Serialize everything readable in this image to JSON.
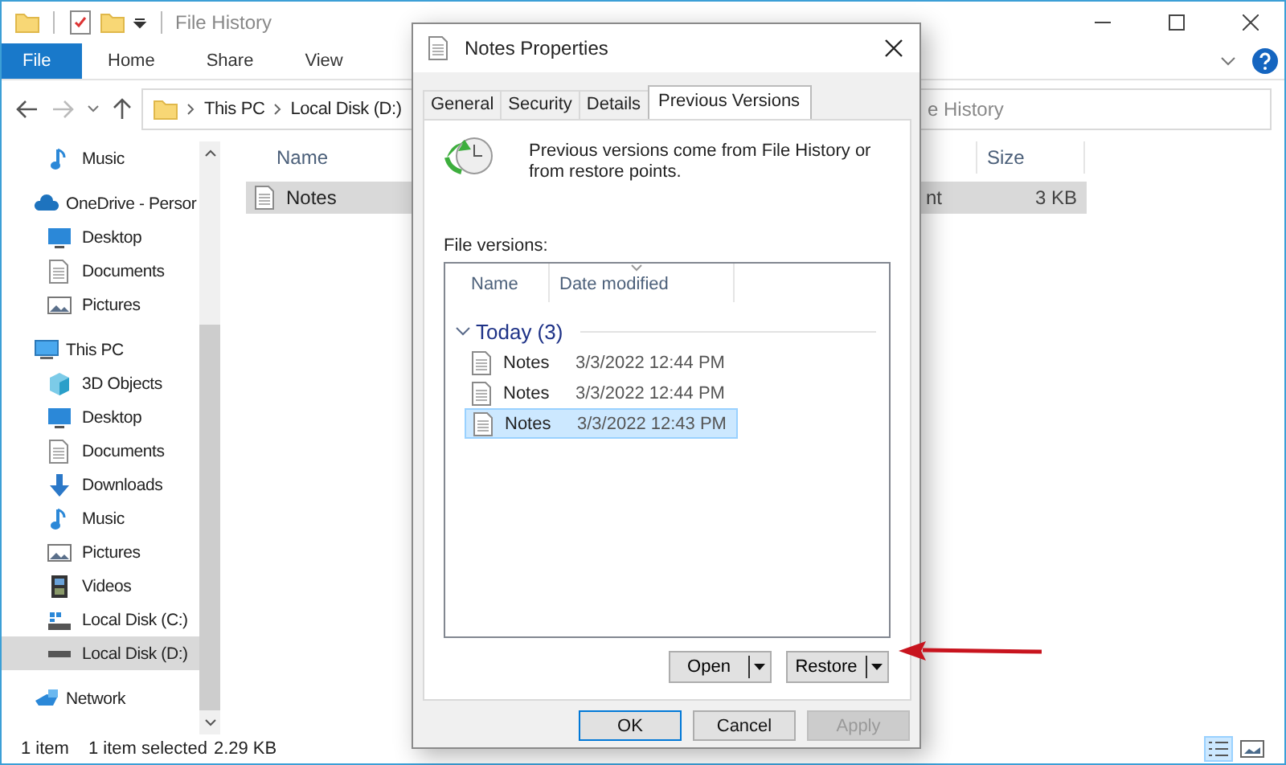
{
  "explorer": {
    "title": "File History",
    "ribbon_tabs": [
      {
        "label": "File",
        "kind": "file"
      },
      {
        "label": "Home",
        "kind": "tab"
      },
      {
        "label": "Share",
        "kind": "tab"
      },
      {
        "label": "View",
        "kind": "tab"
      }
    ],
    "address": {
      "crumbs": [
        "This PC",
        "Local Disk (D:)"
      ]
    },
    "search": {
      "placeholder": "e History"
    },
    "navigation": {
      "items": [
        {
          "children": [
            {
              "label": "Music",
              "kind": "music",
              "selected": false
            }
          ]
        },
        {
          "label": "OneDrive - Persor",
          "kind": "cloud",
          "selected": false,
          "children": [
            {
              "label": "Desktop",
              "kind": "desktop",
              "selected": false
            },
            {
              "label": "Documents",
              "kind": "documents",
              "selected": false
            },
            {
              "label": "Pictures",
              "kind": "pictures",
              "selected": false
            }
          ]
        },
        {
          "label": "This PC",
          "kind": "pc",
          "selected": false,
          "children": [
            {
              "label": "3D Objects",
              "kind": "objects",
              "selected": false
            },
            {
              "label": "Desktop",
              "kind": "desktop",
              "selected": false
            },
            {
              "label": "Documents",
              "kind": "documents",
              "selected": false
            },
            {
              "label": "Downloads",
              "kind": "downloads",
              "selected": false
            },
            {
              "label": "Music",
              "kind": "music",
              "selected": false
            },
            {
              "label": "Pictures",
              "kind": "pictures",
              "selected": false
            },
            {
              "label": "Videos",
              "kind": "videos",
              "selected": false
            },
            {
              "label": "Local Disk (C:)",
              "kind": "system_disk",
              "selected": false
            },
            {
              "label": "Local Disk (D:)",
              "kind": "disk",
              "selected": true
            }
          ]
        },
        {
          "label": "Network",
          "kind": "network",
          "selected": false
        }
      ]
    },
    "file_list": {
      "name_column": "Name",
      "size_column": "Size",
      "rows": [
        {
          "name": "Notes",
          "type": "nt",
          "size": "3 KB",
          "selected": true
        }
      ]
    },
    "status_bar": {
      "count": "1 item",
      "selection": "1 item selected",
      "selection_size": "2.29 KB"
    }
  },
  "dialog": {
    "title": "Notes Properties",
    "tabs": [
      {
        "label": "General",
        "selected": false
      },
      {
        "label": "Security",
        "selected": false
      },
      {
        "label": "Details",
        "selected": false
      },
      {
        "label": "Previous Versions",
        "selected": true
      }
    ],
    "intro": "Previous versions come from File History or from restore points.",
    "versions_label": "File versions:",
    "versions": {
      "columns": [
        "Name",
        "Date modified"
      ],
      "groups": [
        {
          "label": "Today (3)",
          "expanded": true,
          "rows": [
            {
              "name": "Notes",
              "date": "3/3/2022 12:44 PM",
              "selected": false
            },
            {
              "name": "Notes",
              "date": "3/3/2022 12:44 PM",
              "selected": false
            },
            {
              "name": "Notes",
              "date": "3/3/2022 12:43 PM",
              "selected": true
            }
          ]
        }
      ]
    },
    "actions": [
      "Open",
      "Restore"
    ],
    "buttons": [
      {
        "label": "OK",
        "kind": "default",
        "disabled": false
      },
      {
        "label": "Cancel",
        "kind": "normal",
        "disabled": false
      },
      {
        "label": "Apply",
        "kind": "normal",
        "disabled": true
      }
    ]
  }
}
